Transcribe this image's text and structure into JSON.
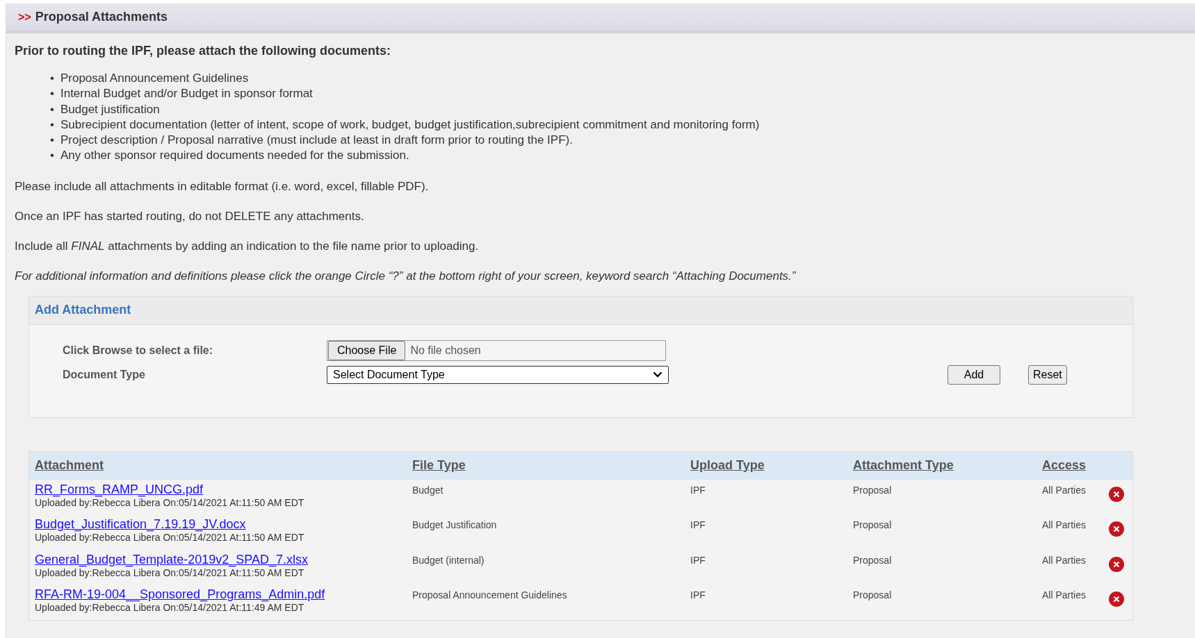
{
  "header": {
    "marker": ">>",
    "title": "Proposal Attachments"
  },
  "intro": "Prior to routing the IPF, please attach the following documents:",
  "bullet": "•",
  "documents": [
    "Proposal Announcement Guidelines",
    "Internal Budget and/or Budget in sponsor format",
    "Budget justification",
    "Subrecipient documentation (letter of intent, scope of work, budget, budget justification,subrecipient commitment and monitoring form)",
    "Project description / Proposal narrative (must include at least in draft form prior to routing the IPF).",
    "Any other sponsor required documents needed for the submission."
  ],
  "notes": [
    {
      "text": "Please include all attachments in editable format (i.e. word, excel, fillable PDF).",
      "italic": false
    },
    {
      "text": "Once an IPF has started routing, do not DELETE any attachments.",
      "italic": false
    },
    {
      "text": "Include all *FINAL* attachments by adding an indication to the file name prior to uploading.",
      "italic": false
    },
    {
      "text": "For additional information and definitions please click the orange Circle “?” at the bottom right of your screen, keyword search “Attaching Documents.”",
      "italic": true
    }
  ],
  "add_attachment": {
    "title": "Add Attachment",
    "file_label": "Click Browse to select a file:",
    "choose_button": "Choose File",
    "file_status": "No file chosen",
    "type_label": "Document Type",
    "type_value": "Select Document Type",
    "add_button": "Add",
    "reset_button": "Reset"
  },
  "table": {
    "columns": [
      "Attachment",
      "File Type",
      "Upload Type",
      "Attachment Type",
      "Access"
    ],
    "rows": [
      {
        "file": "RR_Forms_RAMP_UNCG.pdf",
        "uploaded": "Uploaded by:Rebecca Libera On:05/14/2021 At:11:50 AM EDT",
        "file_type": "Budget",
        "upload_type": "IPF",
        "attachment_type": "Proposal",
        "access": "All Parties"
      },
      {
        "file": "Budget_Justification_7.19.19_JV.docx",
        "uploaded": "Uploaded by:Rebecca Libera On:05/14/2021 At:11:50 AM EDT",
        "file_type": "Budget Justification",
        "upload_type": "IPF",
        "attachment_type": "Proposal",
        "access": "All Parties"
      },
      {
        "file": "General_Budget_Template-2019v2_SPAD_7.xlsx",
        "uploaded": "Uploaded by:Rebecca Libera On:05/14/2021 At:11:50 AM EDT",
        "file_type": "Budget (internal)",
        "upload_type": "IPF",
        "attachment_type": "Proposal",
        "access": "All Parties"
      },
      {
        "file": "RFA-RM-19-004__Sponsored_Programs_Admin.pdf",
        "uploaded": "Uploaded by:Rebecca Libera On:05/14/2021 At:11:49 AM EDT",
        "file_type": "Proposal Announcement Guidelines",
        "upload_type": "IPF",
        "attachment_type": "Proposal",
        "access": "All Parties"
      }
    ]
  }
}
